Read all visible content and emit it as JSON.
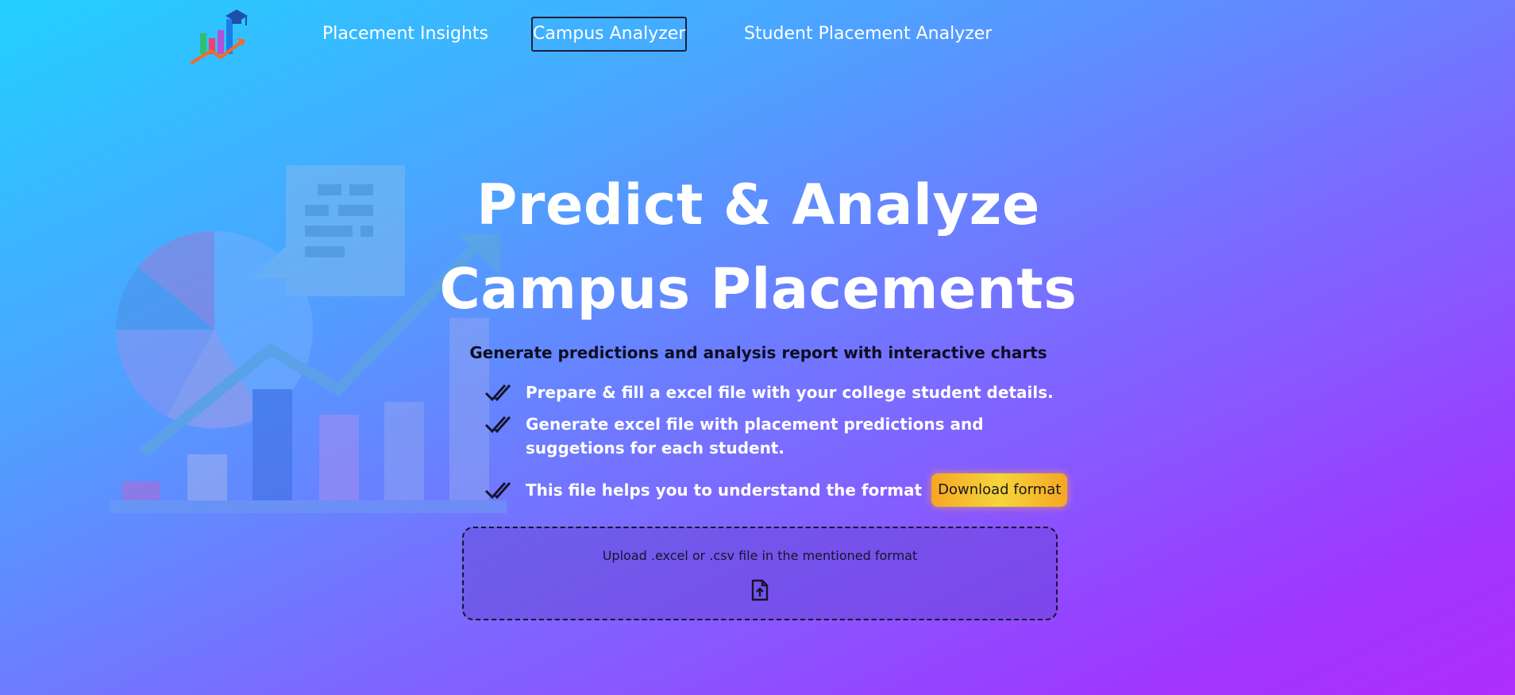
{
  "nav": {
    "links": [
      {
        "label": "Placement Insights"
      },
      {
        "label": "Campus Analyzer",
        "active": true
      },
      {
        "label": "Student Placement Analyzer"
      }
    ]
  },
  "hero": {
    "headline_line1": "Predict & Analyze",
    "headline_line2": "Campus Placements",
    "subhead": "Generate predictions and analysis report with interactive charts",
    "features": [
      "Prepare & fill a excel file with your college student details.",
      "Generate excel file with placement predictions and suggetions for each student.",
      "This file helps you to understand the format"
    ],
    "download_label": "Download format"
  },
  "upload": {
    "label": "Upload .excel or .csv file in the mentioned format",
    "icon": "file-upload-icon"
  },
  "icons": {
    "logo": "bar-chart-graduation-cap-logo",
    "check": "double-check-icon"
  },
  "colors": {
    "gradient_start": "#22d0ff",
    "gradient_end": "#ae2dff",
    "download_button": "#f6a623",
    "active_nav_border": "#1b1f3a"
  }
}
